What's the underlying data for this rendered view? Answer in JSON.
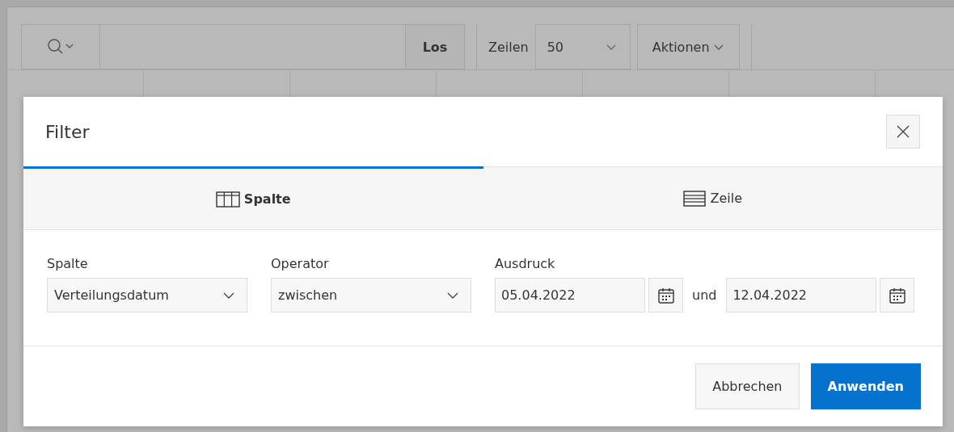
{
  "toolbar": {
    "go_button": "Los",
    "rows_label": "Zeilen",
    "rows_select": "50",
    "actions_button": "Aktionen"
  },
  "dialog": {
    "title": "Filter",
    "tabs": [
      {
        "label": "Spalte",
        "kind": "columns",
        "selected": true
      },
      {
        "label": "Zeile",
        "kind": "rows",
        "selected": false
      }
    ],
    "fields": [
      {
        "kind": "select",
        "label": "Spalte",
        "value": "Verteilungsdatum"
      },
      {
        "kind": "select",
        "label": "Operator",
        "value": "zwischen"
      },
      {
        "kind": "date-range",
        "label": "Ausdruck",
        "from": "05.04.2022",
        "connector": "und",
        "to": "12.04.2022"
      }
    ],
    "buttons": [
      {
        "label": "Abbrechen",
        "kind": "secondary"
      },
      {
        "label": "Anwenden",
        "kind": "primary"
      }
    ]
  }
}
